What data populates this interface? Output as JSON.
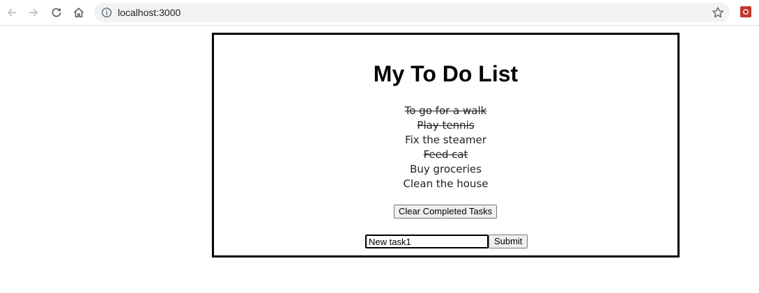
{
  "browser": {
    "url": "localhost:3000",
    "icons": [
      "back-arrow-icon",
      "forward-arrow-icon",
      "reload-icon",
      "home-icon",
      "info-icon",
      "star-icon",
      "extension-icon"
    ]
  },
  "app": {
    "title": "My To Do List",
    "tasks": [
      {
        "label": "To go for a walk",
        "completed": true
      },
      {
        "label": "Play tennis",
        "completed": true
      },
      {
        "label": "Fix the steamer",
        "completed": false
      },
      {
        "label": "Feed cat",
        "completed": true
      },
      {
        "label": "Buy groceries",
        "completed": false
      },
      {
        "label": "Clean the house",
        "completed": false
      }
    ],
    "clear_button_label": "Clear Completed Tasks",
    "new_task_value": "New task1",
    "submit_button_label": "Submit"
  }
}
